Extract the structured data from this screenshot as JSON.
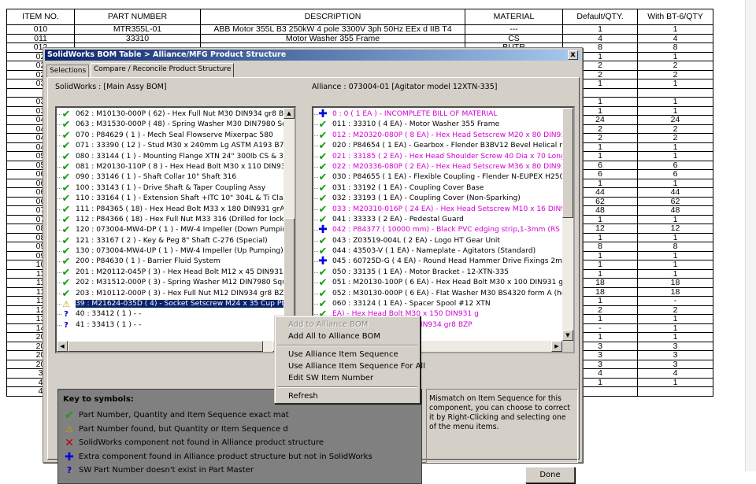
{
  "bom_table": {
    "headers": [
      "ITEM NO.",
      "PART NUMBER",
      "DESCRIPTION",
      "MATERIAL",
      "Default/QTY.",
      "With BT-6/QTY"
    ],
    "rows": [
      [
        "010",
        "MTR355L-01",
        "ABB Motor 355L B3 250kW 4 pole 3300V 3ph 50Hz EEx d IIB T4",
        "---",
        "1",
        "1"
      ],
      [
        "011",
        "33310",
        "Motor Washer 355 Frame",
        "CS",
        "4",
        "4"
      ],
      [
        "012",
        "",
        "",
        "BUTR",
        "8",
        "8"
      ],
      [
        "02",
        "",
        "",
        "",
        "1",
        "1"
      ],
      [
        "02",
        "",
        "",
        "",
        "2",
        "2"
      ],
      [
        "02",
        "",
        "",
        "",
        "2",
        "2"
      ],
      [
        "03",
        "",
        "",
        "",
        "1",
        "1"
      ],
      [
        "",
        "",
        "",
        "",
        "",
        ""
      ],
      [
        "03",
        "",
        "",
        "",
        "1",
        "1"
      ],
      [
        "03",
        "",
        "",
        "",
        "1",
        "1"
      ],
      [
        "04",
        "",
        "",
        "",
        "24",
        "24"
      ],
      [
        "04",
        "",
        "",
        "",
        "2",
        "2"
      ],
      [
        "04",
        "",
        "",
        "",
        "2",
        "2"
      ],
      [
        "04",
        "",
        "",
        "",
        "1",
        "1"
      ],
      [
        "05",
        "",
        "",
        "",
        "1",
        "1"
      ],
      [
        "05",
        "",
        "",
        "",
        "6",
        "6"
      ],
      [
        "06",
        "",
        "",
        "",
        "6",
        "6"
      ],
      [
        "06",
        "",
        "",
        "",
        "1",
        "1"
      ],
      [
        "06",
        "",
        "",
        "",
        "44",
        "44"
      ],
      [
        "06",
        "",
        "",
        "",
        "62",
        "62"
      ],
      [
        "07",
        "",
        "",
        "",
        "48",
        "48"
      ],
      [
        "07",
        "",
        "",
        "",
        "1",
        "1"
      ],
      [
        "08",
        "",
        "",
        "",
        "12",
        "12"
      ],
      [
        "08",
        "",
        "",
        "",
        "1",
        "1"
      ],
      [
        "09",
        "",
        "",
        "",
        "8",
        "8"
      ],
      [
        "09",
        "",
        "",
        "",
        "1",
        "1"
      ],
      [
        "10",
        "",
        "",
        "",
        "1",
        "1"
      ],
      [
        "11",
        "",
        "",
        "",
        "1",
        "1"
      ],
      [
        "11",
        "",
        "",
        "",
        "18",
        "18"
      ],
      [
        "11",
        "",
        "",
        "",
        "18",
        "18"
      ],
      [
        "11",
        "",
        "",
        "",
        "1",
        "-"
      ],
      [
        "12",
        "",
        "",
        "",
        "2",
        "2"
      ],
      [
        "13",
        "",
        "",
        "",
        "1",
        "1"
      ],
      [
        "14",
        "",
        "",
        "",
        "-",
        "1"
      ],
      [
        "20",
        "",
        "",
        "",
        "1",
        "1"
      ],
      [
        "20",
        "",
        "",
        "",
        "3",
        "3"
      ],
      [
        "20",
        "",
        "",
        "",
        "3",
        "3"
      ],
      [
        "20",
        "",
        "",
        "",
        "3",
        "3"
      ],
      [
        "3",
        "",
        "",
        "",
        "4",
        "4"
      ],
      [
        "4",
        "",
        "",
        "",
        "1",
        "1"
      ],
      [
        "4",
        "",
        "",
        "",
        "",
        ""
      ]
    ]
  },
  "dialog": {
    "title": "SolidWorks BOM Table > Alliance/MFG Product Structure",
    "close_glyph": "x",
    "tabs": [
      {
        "label": "Selections",
        "active": false
      },
      {
        "label": "Compare / Reconcile Product Structure",
        "active": true
      }
    ],
    "left_label": "SolidWorks : [Main Assy BOM]",
    "right_label": "Alliance : 073004-01 [Agitator model 12XTN-335]",
    "left_items": [
      {
        "icon": "check",
        "text": "062 : M10130-000P ( 62) - Hex Full Nut M30 DIN934 gr8 BZI"
      },
      {
        "icon": "check",
        "text": "063 : M31530-000P ( 48) - Spring Washer M30 DIN7980 Squ"
      },
      {
        "icon": "check",
        "text": "070 : P84629 ( 1 ) - Mech Seal Flowserve Mixerpac 580"
      },
      {
        "icon": "check",
        "text": "071 : 33390 ( 12 ) - Stud M30 x 240mm Lg ASTM A193 B7"
      },
      {
        "icon": "check",
        "text": "080 : 33144 ( 1 ) - Mounting Flange XTN 24\" 300lb CS & 316l"
      },
      {
        "icon": "check",
        "text": "081 : M20130-110P ( 8 ) - Hex Head Bolt M30 x 110 DIN931"
      },
      {
        "icon": "check",
        "text": "090 : 33146 ( 1 ) - Shaft Collar 10\" Shaft 316"
      },
      {
        "icon": "check",
        "text": "100 : 33143 ( 1 ) - Drive Shaft & Taper Coupling Assy"
      },
      {
        "icon": "check",
        "text": "110 : 33164 ( 1 ) - Extension Shaft +ITC 10\" 304L & Ti Claddi"
      },
      {
        "icon": "check",
        "text": "111 : P84365 ( 18) - Hex Head Bolt M33 x 180 DIN931 grA4-"
      },
      {
        "icon": "check",
        "text": "112 : P84366 ( 18) - Hex Full Nut M33 316 (Drilled for lockwi"
      },
      {
        "icon": "check",
        "text": "120 : 073004-MW4-DP ( 1 ) - MW-4 Impeller (Down Pumping)"
      },
      {
        "icon": "check",
        "text": "121 : 33167 ( 2 ) - Key & Peg 8\" Shaft C-276 (Special)"
      },
      {
        "icon": "check",
        "text": "130 : 073004-MW4-UP ( 1 ) - MW-4 Impeller (Up Pumping) ø1"
      },
      {
        "icon": "check",
        "text": "200 : P84630 ( 1 ) - Barrier Fluid System"
      },
      {
        "icon": "check",
        "text": "201 : M20112-045P ( 3) - Hex Head Bolt M12 x 45 DIN931 g"
      },
      {
        "icon": "check",
        "text": "202 : M31512-000P ( 3) - Spring Washer M12 DIN7980 Squa"
      },
      {
        "icon": "check",
        "text": "203 : M10112-000P ( 3) - Hex Full Nut M12 DIN934 gr8 BZP"
      },
      {
        "icon": "warn",
        "text": "39 : M21624-035D ( 4) - Socket Setscrew M24 x 35 Cup Pt -",
        "selected": true
      },
      {
        "icon": "quest",
        "text": "40 : 33412 ( 1 ) - -"
      },
      {
        "icon": "quest",
        "text": "41 : 33413 ( 1 ) - -"
      }
    ],
    "right_items": [
      {
        "icon": "plus",
        "text": "0 : 0 ( 1 EA ) - INCOMPLETE BILL OF MATERIAL",
        "magenta": true
      },
      {
        "icon": "check",
        "text": "011 : 33310 ( 4 EA) - Motor Washer 355 Frame"
      },
      {
        "icon": "check",
        "text": "012 : M20320-080P ( 8 EA) - Hex Head Setscrew M20 x 80 DIN93",
        "magenta": true
      },
      {
        "icon": "check",
        "text": "020 : P84654 ( 1 EA) - Gearbox - Flender B3BV12 Bevel Helical rat"
      },
      {
        "icon": "check",
        "text": "021 : 33185 ( 2 EA) - Hex Head Shoulder Screw 40 Dia x 70 Long",
        "magenta": true
      },
      {
        "icon": "check",
        "text": "022 : M20336-080P ( 2 EA) - Hex Head Setscrew M36 x 80 DIN93",
        "magenta": true
      },
      {
        "icon": "check",
        "text": "030 : P84655 ( 1 EA) - Flexible Coupling - Flender N-EUPEX H250-"
      },
      {
        "icon": "check",
        "text": "031 : 33192 ( 1 EA) - Coupling Cover Base"
      },
      {
        "icon": "check",
        "text": "032 : 33193 ( 1 EA) - Coupling Cover (Non-Sparking)"
      },
      {
        "icon": "check",
        "text": "033 : M20310-016P ( 24 EA) - Hex Head Setscrew M10 x 16 DIN9",
        "magenta": true
      },
      {
        "icon": "check",
        "text": "041 : 33333 ( 2 EA) - Pedestal Guard"
      },
      {
        "icon": "plus",
        "text": "042 : P84377 ( 10000 mm) - Black PVC edging strip,1-3mm (RS 61",
        "magenta": true
      },
      {
        "icon": "check",
        "text": "043 : Z03519-004L ( 2 EA) - Logo HT Gear Unit"
      },
      {
        "icon": "check",
        "text": "044 : 43503-V ( 1 EA) - Nameplate - Agitators (Standard)"
      },
      {
        "icon": "plus",
        "text": "045 : 60725D-G ( 4 EA) - Round Head Hammer Drive Fixings 2mm"
      },
      {
        "icon": "check",
        "text": "050 : 33135 ( 1 EA) - Motor Bracket - 12-XTN-335"
      },
      {
        "icon": "check",
        "text": "051 : M20130-100P ( 6 EA) - Hex Head Bolt M30 x 100 DIN931 gr"
      },
      {
        "icon": "check",
        "text": "052 : M30130-000P ( 6 EA) - Flat Washer M30 BS4320 form A (hea"
      },
      {
        "icon": "check",
        "text": "060 : 33124 ( 1 EA) - Spacer Spool #12 XTN"
      },
      {
        "icon": "check",
        "text": "EA) - Hex Head Bolt M30 x 150 DIN931 g",
        "magenta": true
      },
      {
        "icon": "check",
        "text": "EA) - Hex Full Nut M30 DIN934 gr8 BZP",
        "magenta": true
      }
    ],
    "key": {
      "title": "Key to symbols:",
      "items": [
        {
          "icon": "check",
          "text": "Part Number, Quantity and Item Sequence exact mat"
        },
        {
          "icon": "warn",
          "text": "Part Number found, but Quantity or Item Sequence d"
        },
        {
          "icon": "cross",
          "text": "SolidWorks component not found in Alliance product structure"
        },
        {
          "icon": "plus",
          "text": "Extra component found in Alliance product structure but not in SolidWorks"
        },
        {
          "icon": "quest",
          "text": "SW Part Number doesn't exist in Part Master"
        }
      ]
    },
    "message": "Mismatch on Item Sequence for this component, you can choose to correct it by Right-Clicking and selecting one of the menu items.",
    "done_label": "Done"
  },
  "context_menu": {
    "items": [
      {
        "label": "Add to Alliance BOM",
        "disabled": true
      },
      {
        "label": "Add All to Alliance BOM",
        "disabled": false
      },
      {
        "separator": true
      },
      {
        "label": "Use Alliance Item Sequence",
        "disabled": false
      },
      {
        "label": "Use Alliance Item Sequence For All",
        "disabled": false
      },
      {
        "label": "Edit SW Item Number",
        "disabled": false
      },
      {
        "separator": true
      },
      {
        "label": "Refresh",
        "disabled": false
      }
    ]
  },
  "icons": {
    "check": "✔",
    "warn": "⚠",
    "cross": "✕",
    "plus": "✚",
    "quest": "?",
    "up": "▲",
    "down": "▼",
    "left": "◀",
    "right": "▶"
  },
  "colors": {
    "title_gradient_start": "#0a246a",
    "check_green": "#1a9a1a",
    "mismatch_magenta": "#d400d4",
    "plus_blue": "#0000e0",
    "dialog_face": "#d4d0c8",
    "key_panel": "#808080"
  }
}
